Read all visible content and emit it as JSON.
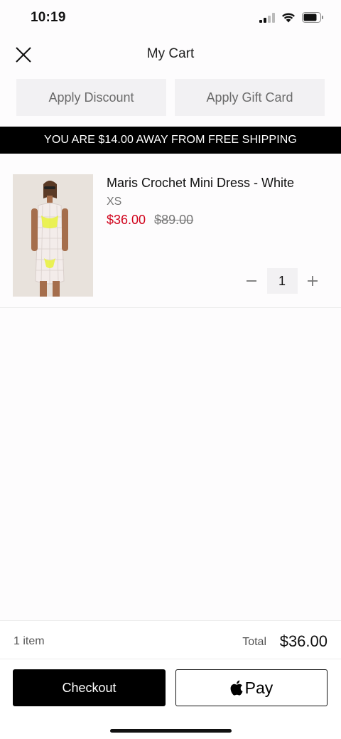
{
  "status_bar": {
    "time": "10:19"
  },
  "header": {
    "title": "My Cart"
  },
  "actions": {
    "discount_label": "Apply Discount",
    "gift_card_label": "Apply Gift Card"
  },
  "banner": {
    "text": "YOU ARE $14.00 AWAY FROM FREE SHIPPING"
  },
  "cart": {
    "items": [
      {
        "name": "Maris Crochet Mini Dress - White",
        "size": "XS",
        "sale_price": "$36.00",
        "original_price": "$89.00",
        "quantity": "1"
      }
    ]
  },
  "summary": {
    "item_count": "1 item",
    "total_label": "Total",
    "total_value": "$36.00"
  },
  "buttons": {
    "checkout_label": "Checkout",
    "applepay_label": "Pay"
  },
  "colors": {
    "sale": "#d0021b",
    "primary": "#000000",
    "secondary_bg": "#f2f1f3"
  },
  "icons": {
    "close": "close-icon",
    "minus": "minus-icon",
    "plus": "plus-icon",
    "apple": "apple-icon"
  }
}
